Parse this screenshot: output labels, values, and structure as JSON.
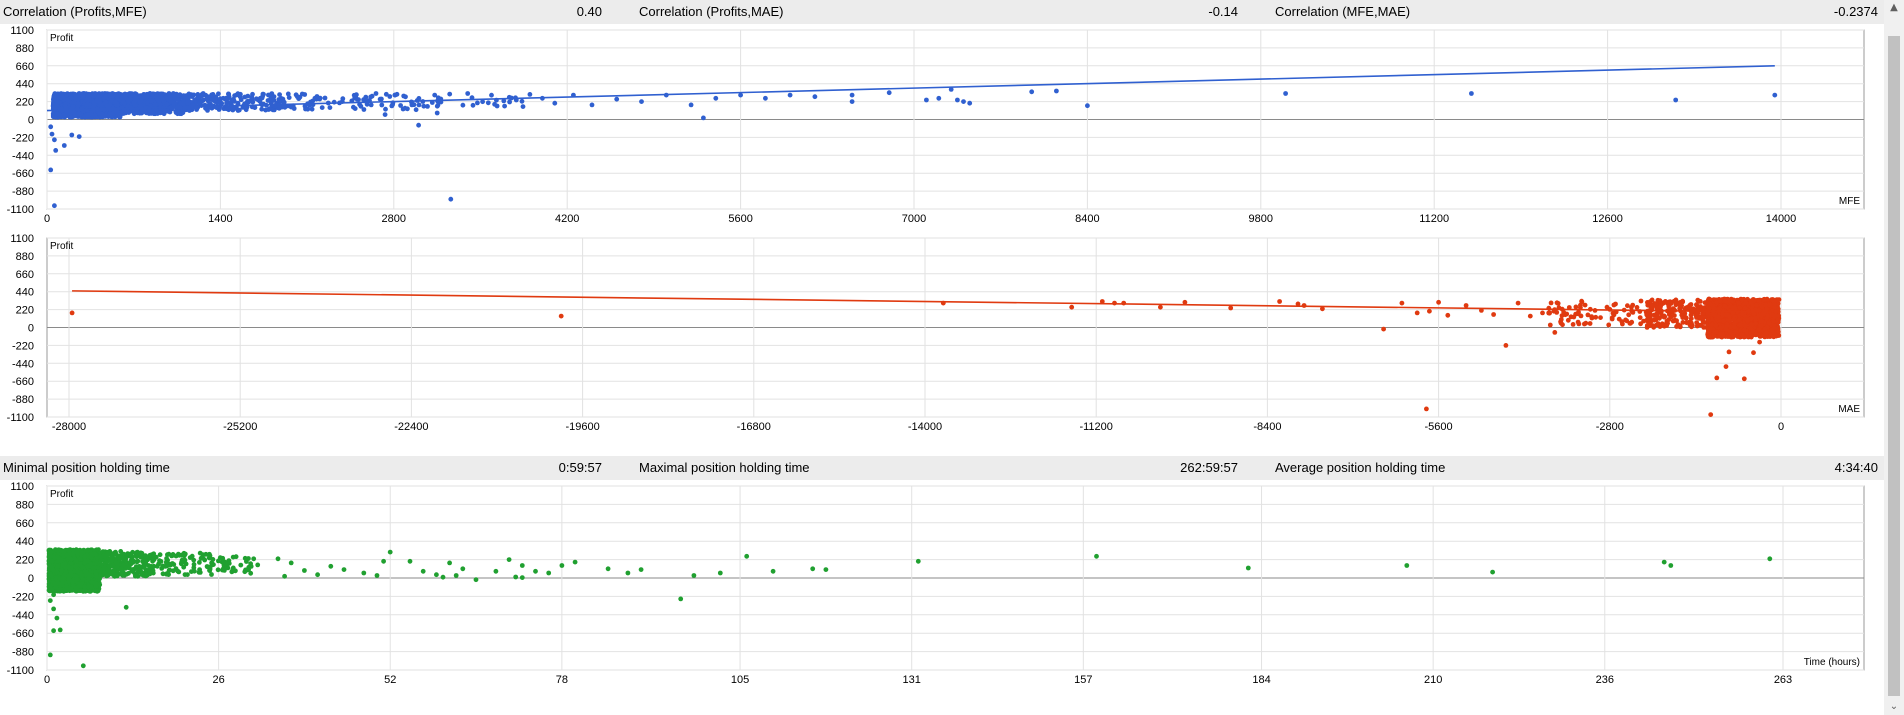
{
  "stats_top": {
    "corr_profit_mfe_label": "Correlation (Profits,MFE)",
    "corr_profit_mfe_value": "0.40",
    "corr_profit_mae_label": "Correlation (Profits,MAE)",
    "corr_profit_mae_value": "-0.14",
    "corr_mfe_mae_label": "Correlation (MFE,MAE)",
    "corr_mfe_mae_value": "-0.2374"
  },
  "stats_bottom": {
    "min_hold_label": "Minimal position holding time",
    "min_hold_value": "0:59:57",
    "max_hold_label": "Maximal position holding time",
    "max_hold_value": "262:59:57",
    "avg_hold_label": "Average position holding time",
    "avg_hold_value": "4:34:40"
  },
  "scrollbar": {
    "up_icon": "triangle-up-icon",
    "down_icon": "chevron-down-icon"
  },
  "chart_data": [
    {
      "id": "mfe",
      "type": "scatter",
      "ylabel": "Profit",
      "xlabel": "MFE",
      "color": "#3060d0",
      "ylim": [
        -1100,
        1100
      ],
      "yticks": [
        1100,
        880,
        660,
        440,
        220,
        0,
        -220,
        -440,
        -660,
        -880,
        -1100
      ],
      "xlim": [
        0,
        14000
      ],
      "xticks": [
        0,
        1400,
        2800,
        4200,
        5600,
        7000,
        8400,
        9800,
        11200,
        12600,
        14000
      ],
      "grid": true,
      "trendline": {
        "x": [
          0,
          13950
        ],
        "y": [
          110,
          660
        ]
      },
      "points": [
        [
          30,
          -90
        ],
        [
          40,
          -180
        ],
        [
          60,
          -250
        ],
        [
          70,
          -380
        ],
        [
          30,
          -620
        ],
        [
          60,
          -1060
        ],
        [
          140,
          -320
        ],
        [
          200,
          -190
        ],
        [
          260,
          -210
        ],
        [
          3260,
          -980
        ],
        [
          3000,
          -70
        ],
        [
          3150,
          80
        ],
        [
          2730,
          60
        ],
        [
          2980,
          120
        ],
        [
          4000,
          260
        ],
        [
          4100,
          200
        ],
        [
          4250,
          300
        ],
        [
          4400,
          180
        ],
        [
          4600,
          250
        ],
        [
          4800,
          220
        ],
        [
          5000,
          300
        ],
        [
          5200,
          180
        ],
        [
          5300,
          20
        ],
        [
          5400,
          260
        ],
        [
          5600,
          300
        ],
        [
          5800,
          260
        ],
        [
          6000,
          300
        ],
        [
          6200,
          280
        ],
        [
          6500,
          300
        ],
        [
          6500,
          220
        ],
        [
          6800,
          330
        ],
        [
          7100,
          240
        ],
        [
          7200,
          260
        ],
        [
          7300,
          370
        ],
        [
          7350,
          240
        ],
        [
          7400,
          220
        ],
        [
          7450,
          200
        ],
        [
          7950,
          340
        ],
        [
          8150,
          350
        ],
        [
          8400,
          170
        ],
        [
          10000,
          320
        ],
        [
          11500,
          320
        ],
        [
          13150,
          240
        ],
        [
          13950,
          300
        ]
      ],
      "clusters": [
        {
          "x0": 50,
          "x1": 600,
          "y0": 30,
          "y1": 320,
          "n": 1300
        },
        {
          "x0": 600,
          "x1": 1100,
          "y0": 70,
          "y1": 320,
          "n": 450
        },
        {
          "x0": 1100,
          "x1": 1900,
          "y0": 110,
          "y1": 320,
          "n": 220
        },
        {
          "x0": 1900,
          "x1": 3000,
          "y0": 120,
          "y1": 320,
          "n": 90
        },
        {
          "x0": 3000,
          "x1": 3900,
          "y0": 140,
          "y1": 320,
          "n": 35
        }
      ]
    },
    {
      "id": "mae",
      "type": "scatter",
      "ylabel": "Profit",
      "xlabel": "MAE",
      "color": "#e03a10",
      "ylim": [
        -1100,
        1100
      ],
      "yticks": [
        1100,
        880,
        660,
        440,
        220,
        0,
        -220,
        -440,
        -660,
        -880,
        -1100
      ],
      "xlim": [
        -28000,
        0
      ],
      "xticks": [
        -28000,
        -25200,
        -22400,
        -19600,
        -16800,
        -14000,
        -11200,
        -8400,
        -5600,
        -2800,
        0
      ],
      "grid": true,
      "trendline": {
        "x": [
          -27950,
          -150
        ],
        "y": [
          450,
          190
        ]
      },
      "points": [
        [
          -27950,
          180
        ],
        [
          -19950,
          140
        ],
        [
          -13700,
          300
        ],
        [
          -11600,
          250
        ],
        [
          -11100,
          320
        ],
        [
          -10900,
          300
        ],
        [
          -10750,
          300
        ],
        [
          -10150,
          250
        ],
        [
          -9750,
          310
        ],
        [
          -9000,
          240
        ],
        [
          -8200,
          320
        ],
        [
          -7900,
          290
        ],
        [
          -7800,
          270
        ],
        [
          -7500,
          230
        ],
        [
          -6500,
          -20
        ],
        [
          -6200,
          300
        ],
        [
          -5950,
          180
        ],
        [
          -5750,
          200
        ],
        [
          -5600,
          310
        ],
        [
          -5450,
          150
        ],
        [
          -5800,
          -1000
        ],
        [
          -5150,
          270
        ],
        [
          -4900,
          210
        ],
        [
          -4700,
          160
        ],
        [
          -4500,
          -220
        ],
        [
          -4300,
          300
        ],
        [
          -4100,
          140
        ],
        [
          -3900,
          180
        ],
        [
          -3700,
          -60
        ],
        [
          -1150,
          -1070
        ],
        [
          -1050,
          -620
        ],
        [
          -900,
          -480
        ],
        [
          -850,
          -300
        ],
        [
          -600,
          -630
        ],
        [
          -450,
          -310
        ],
        [
          -350,
          -180
        ]
      ],
      "clusters": [
        {
          "x0": -3800,
          "x1": -2200,
          "y0": 30,
          "y1": 330,
          "n": 80
        },
        {
          "x0": -2200,
          "x1": -1200,
          "y0": 0,
          "y1": 340,
          "n": 200
        },
        {
          "x0": -1200,
          "x1": -30,
          "y0": -120,
          "y1": 350,
          "n": 1400
        }
      ]
    },
    {
      "id": "time",
      "type": "scatter",
      "ylabel": "Profit",
      "xlabel": "Time (hours)",
      "color": "#20a030",
      "ylim": [
        -1100,
        1100
      ],
      "yticks": [
        1100,
        880,
        660,
        440,
        220,
        0,
        -220,
        -440,
        -660,
        -880,
        -1100
      ],
      "xlim": [
        0,
        263
      ],
      "xticks": [
        0,
        26,
        52,
        78,
        105,
        131,
        157,
        184,
        210,
        236,
        263
      ],
      "grid": true,
      "points": [
        [
          0.5,
          -920
        ],
        [
          1,
          -630
        ],
        [
          2,
          -620
        ],
        [
          5.5,
          -1050
        ],
        [
          12,
          -350
        ],
        [
          1,
          -370
        ],
        [
          1.5,
          -480
        ],
        [
          0.5,
          -270
        ],
        [
          1,
          -200
        ],
        [
          35,
          230
        ],
        [
          37,
          180
        ],
        [
          36,
          20
        ],
        [
          39,
          90
        ],
        [
          41,
          40
        ],
        [
          43,
          140
        ],
        [
          45,
          100
        ],
        [
          48,
          60
        ],
        [
          50,
          30
        ],
        [
          51,
          200
        ],
        [
          52,
          310
        ],
        [
          55,
          200
        ],
        [
          57,
          80
        ],
        [
          59,
          40
        ],
        [
          61,
          180
        ],
        [
          62,
          30
        ],
        [
          63,
          110
        ],
        [
          65,
          -20
        ],
        [
          68,
          80
        ],
        [
          70,
          220
        ],
        [
          72,
          150
        ],
        [
          74,
          80
        ],
        [
          76,
          60
        ],
        [
          78,
          150
        ],
        [
          80,
          190
        ],
        [
          85,
          110
        ],
        [
          88,
          60
        ],
        [
          90,
          100
        ],
        [
          96,
          -250
        ],
        [
          98,
          30
        ],
        [
          102,
          60
        ],
        [
          106,
          260
        ],
        [
          110,
          80
        ],
        [
          116,
          110
        ],
        [
          118,
          100
        ],
        [
          132,
          200
        ],
        [
          159,
          260
        ],
        [
          182,
          120
        ],
        [
          206,
          150
        ],
        [
          219,
          70
        ],
        [
          245,
          190
        ],
        [
          246,
          150
        ],
        [
          261,
          230
        ],
        [
          72,
          5
        ],
        [
          71,
          12
        ],
        [
          60,
          10
        ]
      ],
      "clusters": [
        {
          "x0": 0.3,
          "x1": 8,
          "y0": -160,
          "y1": 340,
          "n": 1100
        },
        {
          "x0": 8,
          "x1": 16,
          "y0": 20,
          "y1": 320,
          "n": 250
        },
        {
          "x0": 16,
          "x1": 25,
          "y0": 40,
          "y1": 300,
          "n": 90
        },
        {
          "x0": 25,
          "x1": 32,
          "y0": 50,
          "y1": 260,
          "n": 40
        }
      ]
    }
  ]
}
